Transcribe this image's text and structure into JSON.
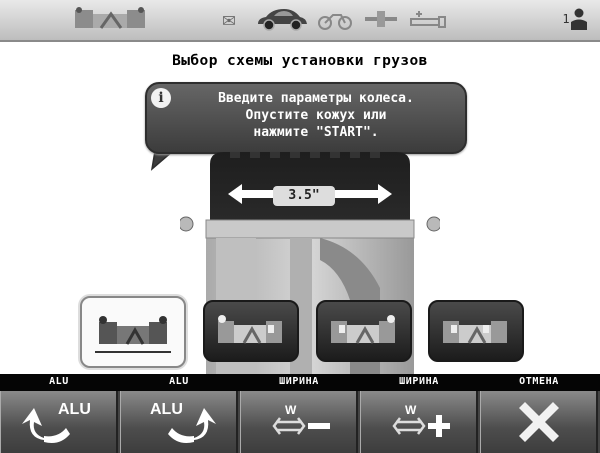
{
  "title": "Выбор схемы установки грузов",
  "info": {
    "lines": [
      "Введите параметры колеса.",
      "Опустите кожух или",
      "нажмите \"START\"."
    ]
  },
  "wheel": {
    "width_value": "3.5\""
  },
  "topbar": {
    "user_number": "1"
  },
  "schemes": [
    {
      "id": "scheme-1",
      "selected": true
    },
    {
      "id": "scheme-2",
      "selected": false
    },
    {
      "id": "scheme-3",
      "selected": false
    },
    {
      "id": "scheme-4",
      "selected": false
    }
  ],
  "function_keys": [
    {
      "label": "ALU",
      "icon_text": "ALU",
      "icon": "alu-rotate-left-icon"
    },
    {
      "label": "ALU",
      "icon_text": "ALU",
      "icon": "alu-rotate-right-icon"
    },
    {
      "label": "ШИРИНА",
      "icon_text": "W",
      "icon": "width-minus-icon"
    },
    {
      "label": "ШИРИНА",
      "icon_text": "W",
      "icon": "width-plus-icon"
    },
    {
      "label": "ОТМЕНА",
      "icon_text": "",
      "icon": "cancel-x-icon"
    }
  ],
  "colors": {
    "accent": "#3a3a3a",
    "bar": "#050505"
  }
}
